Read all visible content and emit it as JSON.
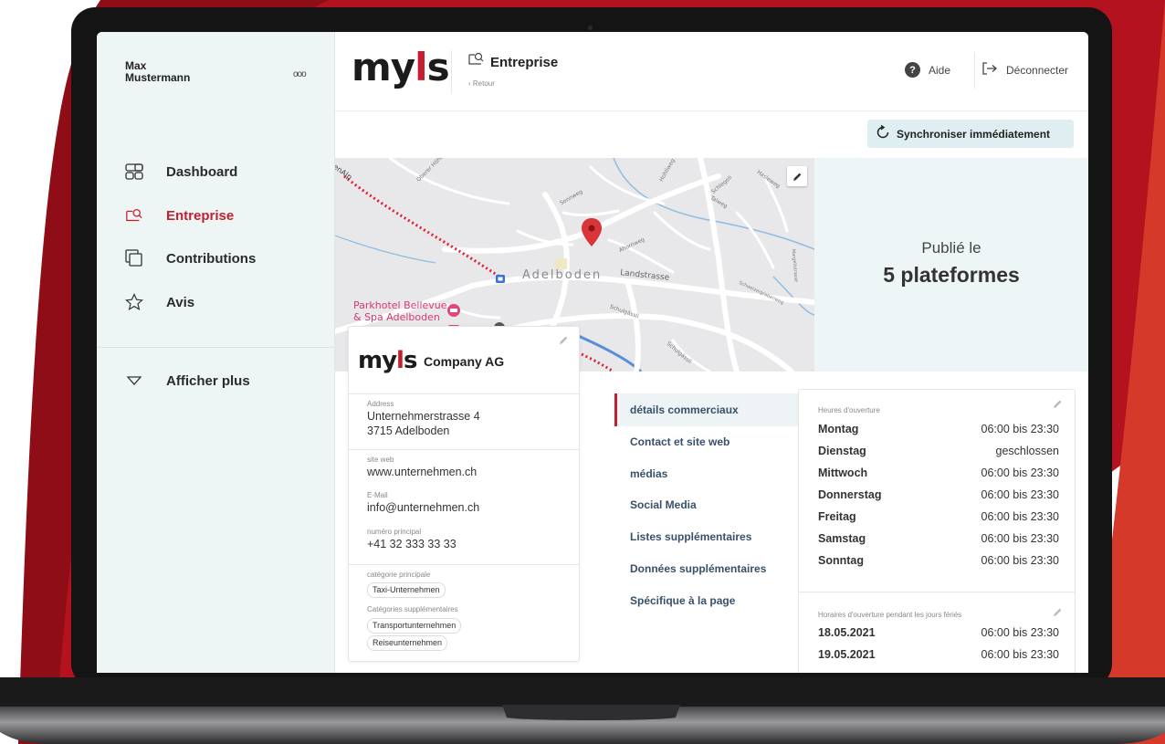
{
  "sidebar": {
    "user_name": "Max\nMustermann",
    "more_label": "ooo",
    "items": [
      {
        "label": "Dashboard",
        "icon": "dashboard-icon"
      },
      {
        "label": "Entreprise",
        "icon": "company-icon",
        "active": true
      },
      {
        "label": "Contributions",
        "icon": "contributions-icon"
      },
      {
        "label": "Avis",
        "icon": "star-icon"
      }
    ],
    "more": "Afficher plus"
  },
  "header": {
    "logo_left": "my",
    "logo_mid": "l",
    "logo_right": "s",
    "title": "Entreprise",
    "back": "‹ Retour",
    "help": "Aide",
    "logout": "Déconnecter"
  },
  "sync_label": "Synchroniser immédiatement",
  "map": {
    "town": "Adelboden",
    "street": "Landstrasse",
    "poi_line1": "Parkhotel Bellevue",
    "poi_line2": "& Spa Adelboden",
    "edge_label": "tenAlp",
    "street_labels": [
      "Oberer Höhe",
      "Sonnweg",
      "Schlegeli",
      "Talweg",
      "Hohliweg",
      "Ahornweg",
      "Schulgässli",
      "Schweizergrabenweg",
      "Margelistrasse",
      "Hasleweg",
      "Schulgässli"
    ]
  },
  "published": {
    "label": "Publié le",
    "value": "5 plateformes"
  },
  "company": {
    "logo_left": "my",
    "logo_mid": "l",
    "logo_right": "s",
    "name": "Company AG",
    "address_label": "Address",
    "address_line1": "Unternehmerstrasse 4",
    "address_line2": "3715 Adelboden",
    "website_label": "site web",
    "website": "www.unternehmen.ch",
    "email_label": "E-Mail",
    "email": "info@unternehmen.ch",
    "phone_label": "numéro principal",
    "phone": "+41 32 333 33 33",
    "main_cat_label": "catégorie principale",
    "main_cat": "Taxi-Unternehmen",
    "extra_cat_label": "Catégories supplémentaires",
    "extra_cats": [
      "Transportunternehmen",
      "Reiseunternehmen"
    ]
  },
  "tabs": [
    "détails commerciaux",
    "Contact et site web",
    "médias",
    "Social Media",
    "Listes supplémentaires",
    "Données supplémentaires",
    "Spécifique à la page"
  ],
  "hours": {
    "label": "Heures d'ouverture",
    "rows": [
      {
        "day": "Montag",
        "time": "06:00 bis 23:30"
      },
      {
        "day": "Dienstag",
        "time": "geschlossen"
      },
      {
        "day": "Mittwoch",
        "time": "06:00 bis 23:30"
      },
      {
        "day": "Donnerstag",
        "time": "06:00 bis 23:30"
      },
      {
        "day": "Freitag",
        "time": "06:00 bis 23:30"
      },
      {
        "day": "Samstag",
        "time": "06:00 bis 23:30"
      },
      {
        "day": "Sonntag",
        "time": "06:00 bis 23:30"
      }
    ]
  },
  "holidays": {
    "label": "Horaires d'ouverture pendant les jours fériés",
    "rows": [
      {
        "day": "18.05.2021",
        "time": "06:00 bis 23:30"
      },
      {
        "day": "19.05.2021",
        "time": "06:00 bis 23:30"
      }
    ]
  },
  "colors": {
    "accent": "#c51e2e",
    "background_red": "#b5121f",
    "sidebar": "#eef5f5"
  }
}
